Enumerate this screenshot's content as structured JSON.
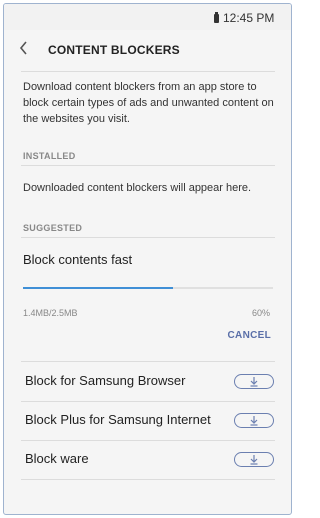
{
  "status_bar": {
    "time": "12:45 PM",
    "battery_icon": "battery-icon"
  },
  "header": {
    "back_icon": "chevron-left-icon",
    "title": "CONTENT BLOCKERS"
  },
  "description": "Download content blockers from an app store to block certain types of ads and unwanted content on the websites you visit.",
  "installed": {
    "header": "INSTALLED",
    "empty_text": "Downloaded content blockers will appear here."
  },
  "suggested": {
    "header": "SUGGESTED",
    "downloading": {
      "title": "Block contents fast",
      "size": "1.4MB/2.5MB",
      "percent_label": "60%",
      "progress": 0.6,
      "cancel_label": "CANCEL"
    },
    "items": [
      {
        "label": "Block for Samsung Browser",
        "icon": "download-icon"
      },
      {
        "label": "Block Plus for Samsung Internet",
        "icon": "download-icon"
      },
      {
        "label": "Block ware",
        "icon": "download-icon"
      }
    ]
  },
  "colors": {
    "accent": "#3f8fd6",
    "button_text": "#5a6fa8"
  }
}
